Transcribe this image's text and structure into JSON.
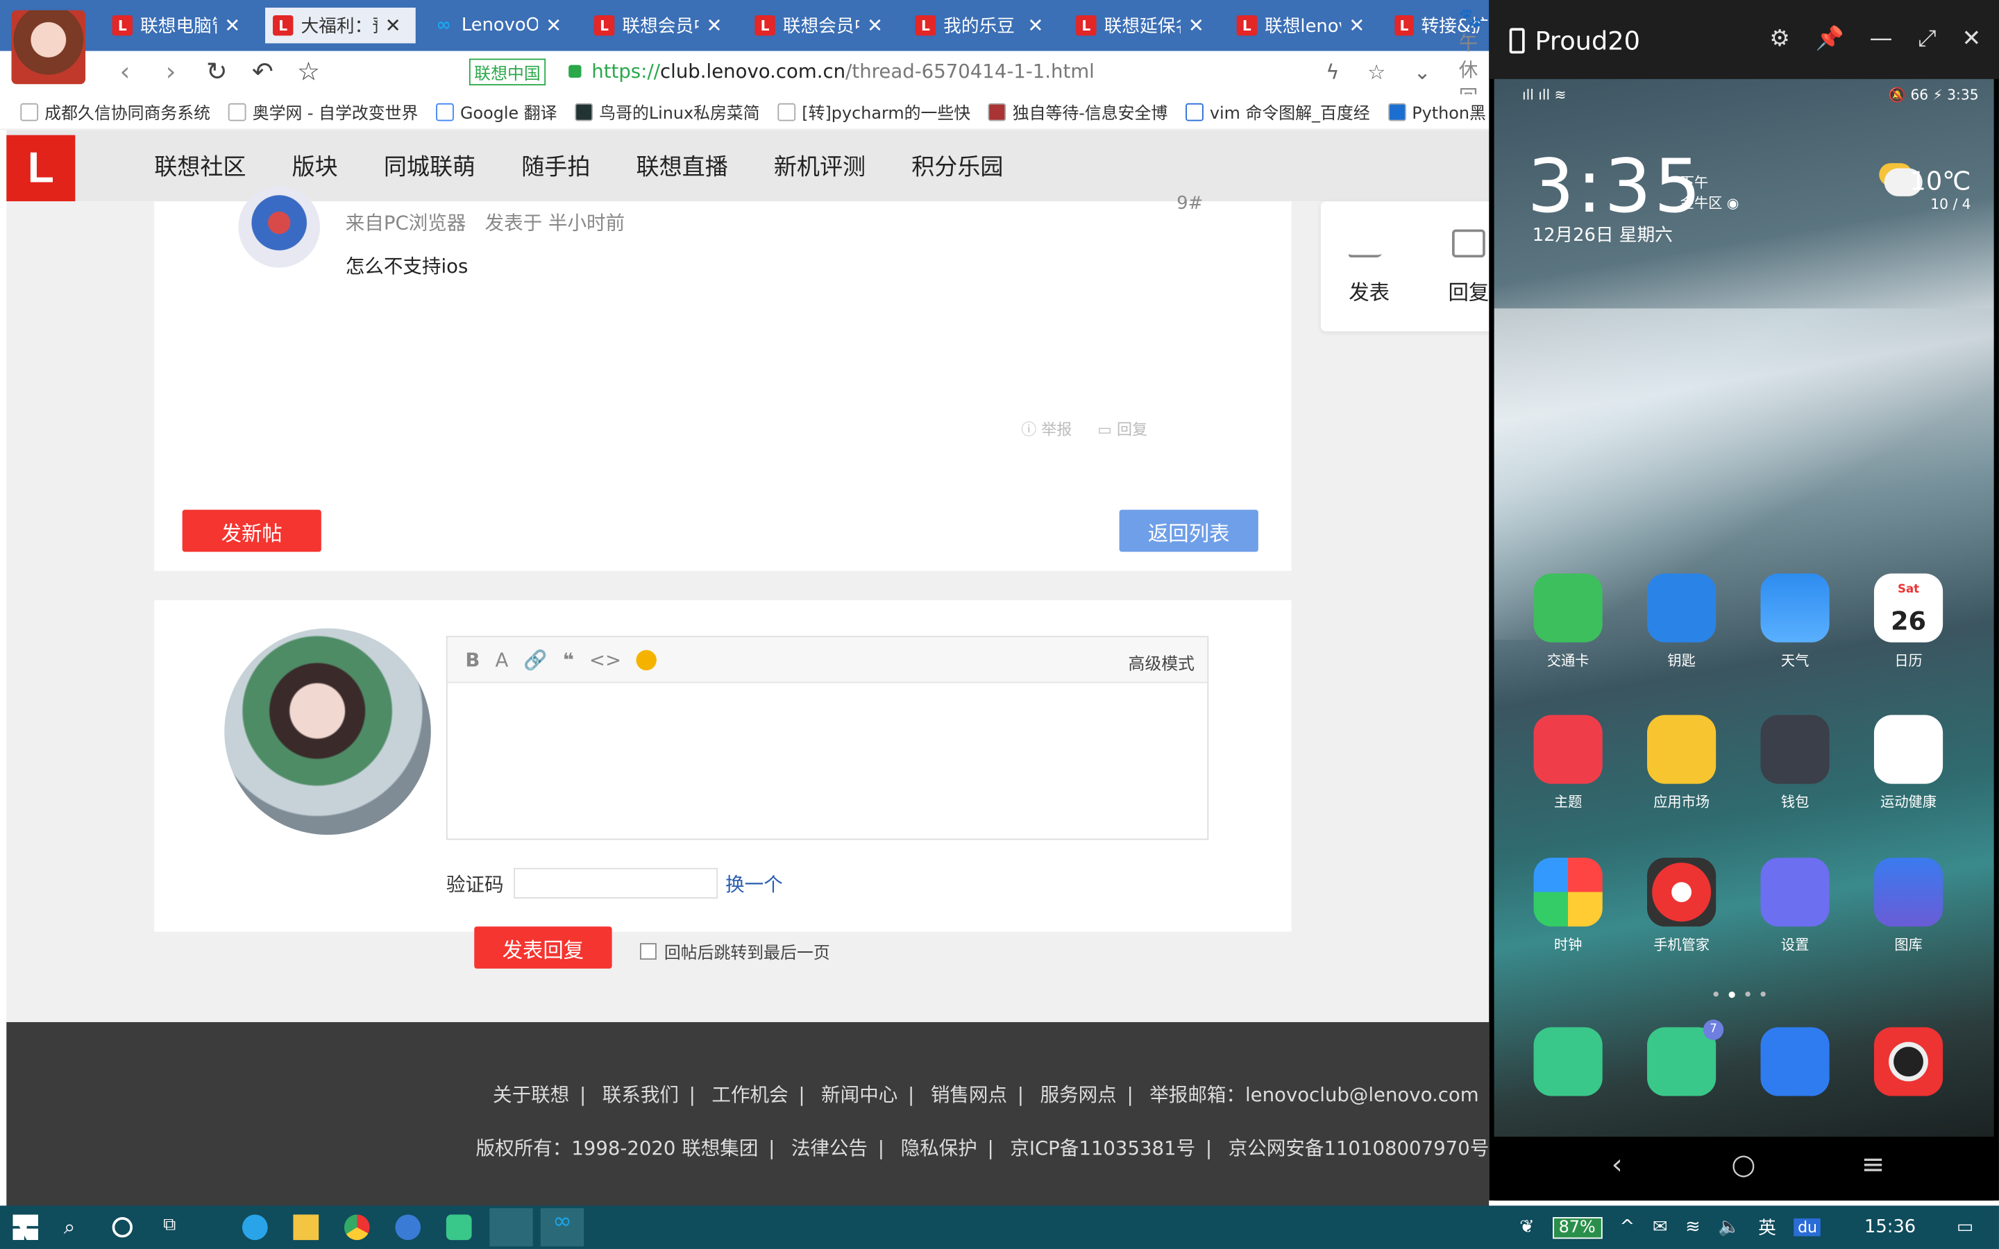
{
  "browser": {
    "tabs": [
      {
        "label": "联想电脑管",
        "active": false
      },
      {
        "label": "大福利：预",
        "active": true
      },
      {
        "label": "LenovoOr",
        "active": false
      },
      {
        "label": "联想会员中",
        "active": false
      },
      {
        "label": "联想会员中",
        "active": false
      },
      {
        "label": "我的乐豆",
        "active": false
      },
      {
        "label": "联想延保名",
        "active": false
      },
      {
        "label": "联想lenov",
        "active": false
      },
      {
        "label": "转接&扩",
        "active": false
      }
    ],
    "cert_label": "联想中国",
    "url_scheme": "https://",
    "url_host": "club.lenovo.com.cn",
    "url_path": "/thread-6570414-1-1.html",
    "search_hint": "午休回家",
    "bookmarks": [
      "成都久信协同商务系统",
      "奥学网 - 自学改变世界",
      "Google 翻译",
      "鸟哥的Linux私房菜简",
      "[转]pycharm的一些快",
      "独自等待-信息安全博",
      "vim 命令图解_百度经",
      "Python黑"
    ]
  },
  "site": {
    "logo": "L",
    "nav": [
      "联想社区",
      "版块",
      "同城联萌",
      "随手拍",
      "联想直播",
      "新机评测",
      "积分乐园"
    ],
    "post": {
      "source": "来自PC浏览器",
      "posted": "发表于 半小时前",
      "text": "怎么不支持ios",
      "floor": "9#",
      "report": "举报",
      "reply": "回复"
    },
    "new_post_btn": "发新帖",
    "back_list_btn": "返回列表",
    "side": {
      "post": "发表",
      "reply": "回复"
    },
    "editor": {
      "tools": [
        "B",
        "A",
        "🔗",
        "❝",
        "<>"
      ],
      "adv_mode": "高级模式"
    },
    "captcha": {
      "label": "验证码",
      "refresh": "换一个"
    },
    "submit_reply": "发表回复",
    "jump_last": "回帖后跳转到最后一页",
    "footer": {
      "links": [
        "关于联想",
        "联系我们",
        "工作机会",
        "新闻中心",
        "销售网点",
        "服务网点"
      ],
      "email": "举报邮箱：lenovoclub@lenovo.com",
      "copyright": "版权所有：1998-2020 联想集团",
      "legal": [
        "法律公告",
        "隐私保护",
        "京ICP备11035381号",
        "京公网安备110108007970号"
      ]
    }
  },
  "phone": {
    "title": "Proud20",
    "status_time": "3:35",
    "status_battery": "66",
    "clock": "3:35",
    "ampm": "下午",
    "location": "金牛区",
    "date": "12月26日 星期六",
    "temp": "10℃",
    "range": "10 / 4",
    "calendar_day": "26",
    "calendar_dow": "Sat",
    "apps_row1": [
      "交通卡",
      "钥匙",
      "天气",
      "日历"
    ],
    "apps_row2": [
      "主题",
      "应用市场",
      "钱包",
      "运动健康"
    ],
    "apps_row3": [
      "时钟",
      "手机管家",
      "设置",
      "图库"
    ],
    "badge": "7"
  },
  "taskbar": {
    "battery": "87%",
    "ime": "英",
    "ime2": "du",
    "time": "15:36"
  }
}
